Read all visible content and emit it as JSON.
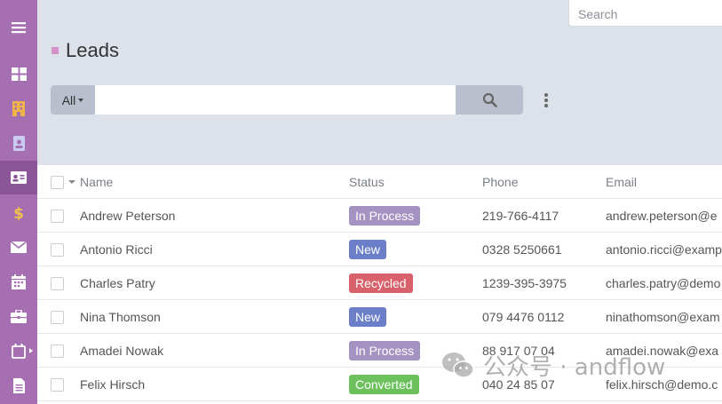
{
  "app": {
    "page_title": "Leads",
    "accent": "#a66fb1"
  },
  "sidebar": {
    "items": [
      {
        "icon": "hamburger-menu-icon"
      },
      {
        "icon": "dashboard-icon"
      },
      {
        "icon": "building-icon"
      },
      {
        "icon": "contact-badge-icon"
      },
      {
        "icon": "id-card-icon",
        "active": true
      },
      {
        "icon": "dollar-icon"
      },
      {
        "icon": "envelope-icon"
      },
      {
        "icon": "calendar-icon"
      },
      {
        "icon": "briefcase-icon"
      },
      {
        "icon": "calendar-check-icon"
      },
      {
        "icon": "document-icon"
      }
    ]
  },
  "topbar": {
    "search_placeholder": "Search"
  },
  "filter": {
    "scope_label": "All",
    "query_value": ""
  },
  "table": {
    "columns": [
      "Name",
      "Status",
      "Phone",
      "Email"
    ],
    "rows": [
      {
        "name": "Andrew Peterson",
        "status": "In Process",
        "phone": "219-766-4117",
        "email": "andrew.peterson@e"
      },
      {
        "name": "Antonio Ricci",
        "status": "New",
        "phone": "0328 5250661",
        "email": "antonio.ricci@examp"
      },
      {
        "name": "Charles Patry",
        "status": "Recycled",
        "phone": "1239-395-3975",
        "email": "charles.patry@demo"
      },
      {
        "name": "Nina Thomson",
        "status": "New",
        "phone": "079 4476 0112",
        "email": "ninathomson@exam"
      },
      {
        "name": "Amadei Nowak",
        "status": "In Process",
        "phone": "88 917 07 04",
        "email": "amadei.nowak@exa"
      },
      {
        "name": "Felix Hirsch",
        "status": "Converted",
        "phone": "040 24 85 07",
        "email": "felix.hirsch@demo.c"
      }
    ]
  },
  "status_colors": {
    "In Process": "#a392c2",
    "New": "#6b7fc8",
    "Recycled": "#d9616b",
    "Converted": "#6cc15d"
  },
  "watermark": {
    "text": "公众号 · andflow"
  }
}
